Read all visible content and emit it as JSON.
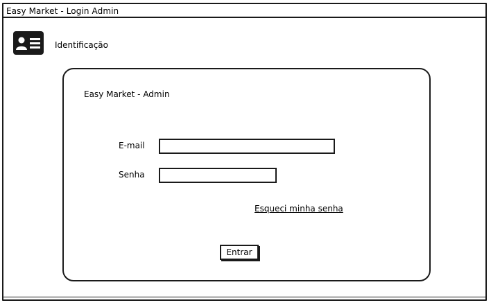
{
  "window": {
    "title": "Easy Market - Login Admin"
  },
  "header": {
    "icon": "id-card-icon",
    "label": "Identificação"
  },
  "login_panel": {
    "title": "Easy Market - Admin",
    "email_label": "E-mail",
    "email_value": "",
    "password_label": "Senha",
    "password_value": "",
    "forgot_password_link": "Esqueci minha senha",
    "submit_label": "Entrar"
  }
}
